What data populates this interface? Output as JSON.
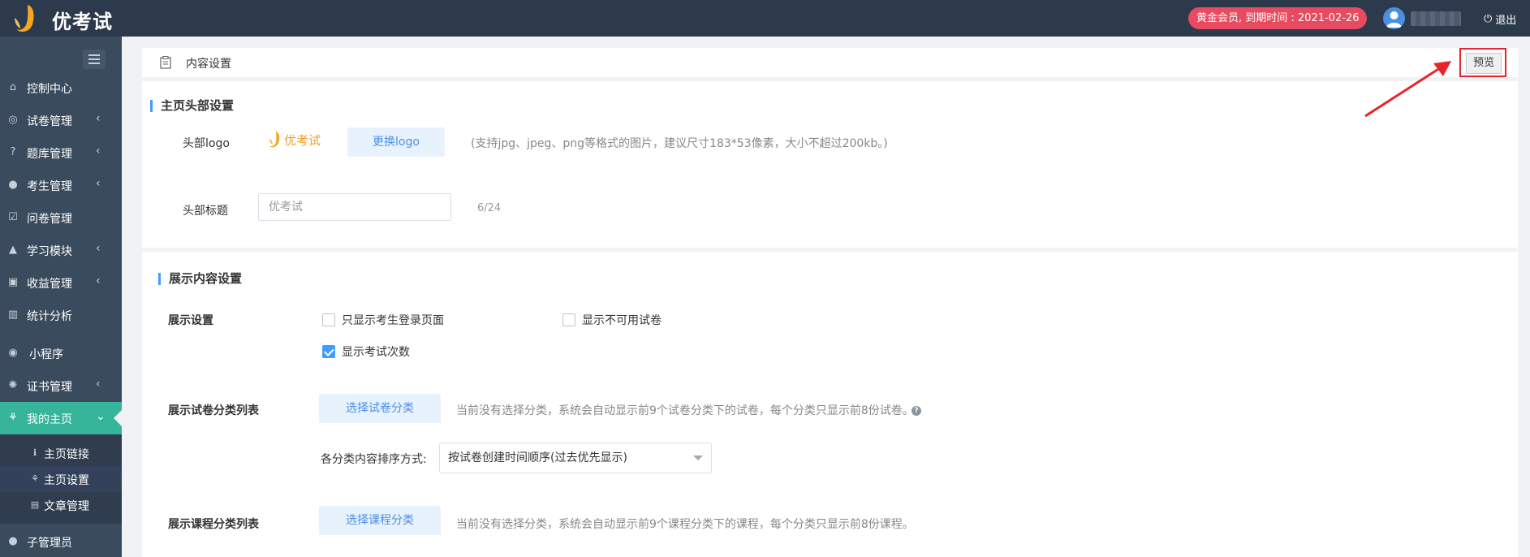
{
  "app": {
    "name": "优考试",
    "brand_color": "#f0a030"
  },
  "topbar": {
    "member_badge": "黄金会员, 到期时间 : 2021-02-26",
    "logout_label": "退出"
  },
  "sidebar": {
    "items": [
      {
        "label": "控制中心",
        "icon": "home-icon"
      },
      {
        "label": "试卷管理",
        "icon": "check-circle-icon"
      },
      {
        "label": "题库管理",
        "icon": "question-circle-icon"
      },
      {
        "label": "考生管理",
        "icon": "user-icon"
      },
      {
        "label": "问卷管理",
        "icon": "checkbox-icon"
      },
      {
        "label": "学习模块",
        "icon": "graduation-cap-icon"
      },
      {
        "label": "收益管理",
        "icon": "money-icon"
      },
      {
        "label": "统计分析",
        "icon": "bar-chart-icon"
      },
      {
        "label": "小程序",
        "icon": "wechat-icon"
      },
      {
        "label": "证书管理",
        "icon": "gear-icon"
      },
      {
        "label": "我的主页",
        "icon": "tree-icon"
      },
      {
        "label": "子管理员",
        "icon": "user-icon"
      }
    ],
    "subitems": [
      {
        "label": "主页链接",
        "icon": "info-icon"
      },
      {
        "label": "主页设置",
        "icon": "tree-icon"
      },
      {
        "label": "文章管理",
        "icon": "file-icon"
      }
    ],
    "active_item": "我的主页",
    "active_subitem": "主页设置",
    "accent_color": "#37b59a"
  },
  "header": {
    "title": "内容设置",
    "preview_label": "预览"
  },
  "section1": {
    "title": "主页头部设置",
    "logo_label": "头部logo",
    "logo_preview_text": "优考试",
    "change_logo_label": "更换logo",
    "logo_hint": "(支持jpg、jpeg、png等格式的图片，建议尺寸183*53像素，大小不超过200kb。)",
    "title_label": "头部标题",
    "title_placeholder": "优考试",
    "title_counter": "6/24"
  },
  "section2": {
    "title": "展示内容设置",
    "display_label": "展示设置",
    "options": [
      {
        "label": "只显示考生登录页面",
        "checked": false
      },
      {
        "label": "显示不可用试卷",
        "checked": false
      },
      {
        "label": "显示考试次数",
        "checked": true
      }
    ],
    "exam_category_label": "展示试卷分类列表",
    "select_exam_category_btn": "选择试卷分类",
    "exam_category_hint": "当前没有选择分类，系统会自动显示前9个试卷分类下的试卷，每个分类只显示前8份试卷。",
    "sort_label": "各分类内容排序方式:",
    "sort_value": "按试卷创建时间顺序(过去优先显示)",
    "course_category_label": "展示课程分类列表",
    "select_course_category_btn": "选择课程分类",
    "course_category_hint": "当前没有选择分类，系统会自动显示前9个课程分类下的课程，每个分类只显示前8份课程。"
  }
}
